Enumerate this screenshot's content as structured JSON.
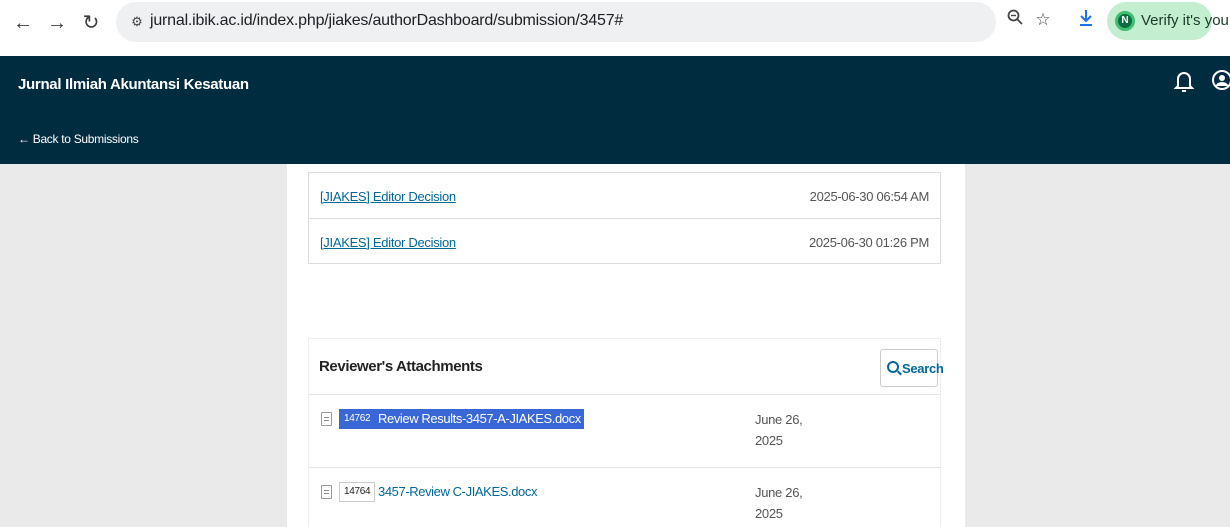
{
  "browser": {
    "url": "jurnal.ibik.ac.id/index.php/jiakes/authorDashboard/submission/3457#",
    "verify_label": "Verify it's you",
    "verify_badge": "N"
  },
  "header": {
    "site_title": "Jurnal Ilmiah Akuntansi Kesatuan",
    "back_label": "← Back to Submissions"
  },
  "emails": [
    {
      "subject": "[JIAKES] Editor Decision",
      "date": "2025-06-30 06:54 AM"
    },
    {
      "subject": "[JIAKES] Editor Decision",
      "date": "2025-06-30 01:26 PM"
    }
  ],
  "attachments": {
    "title": "Reviewer's Attachments",
    "search_label": "Search",
    "files": [
      {
        "id": "14762",
        "name": "Review Results-3457-A-JIAKES.docx",
        "date_line1": "June 26,",
        "date_line2": "2025",
        "selected": true
      },
      {
        "id": "14764",
        "name": "3457-Review C-JIAKES.docx",
        "date_line1": "June 26,",
        "date_line2": "2025",
        "selected": false
      }
    ]
  },
  "colors": {
    "header_bg": "#002c40",
    "link": "#006798",
    "selection": "#3a67d6",
    "verify_chip": "#c4eed0"
  }
}
